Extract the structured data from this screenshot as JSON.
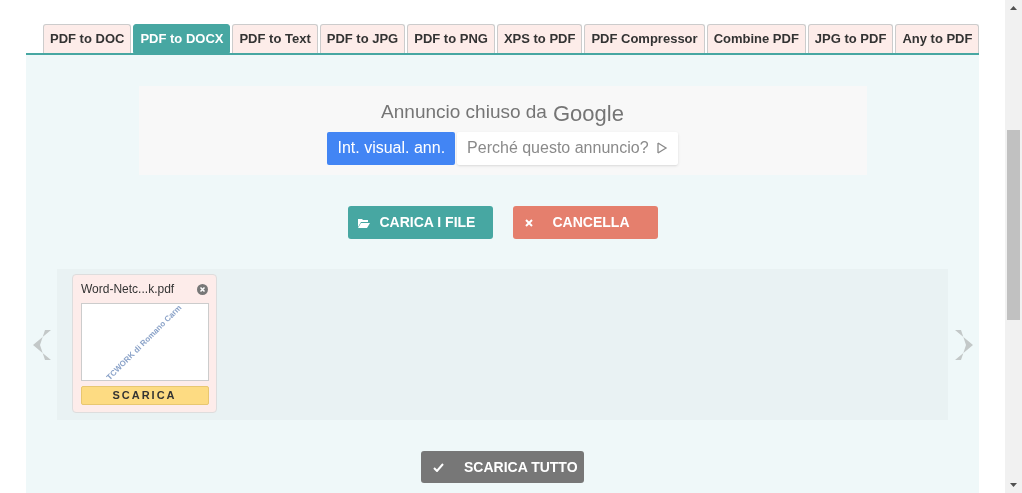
{
  "tabs": [
    {
      "label": "PDF to DOC",
      "selected": false
    },
    {
      "label": "PDF to DOCX",
      "selected": true
    },
    {
      "label": "PDF to Text",
      "selected": false
    },
    {
      "label": "PDF to JPG",
      "selected": false
    },
    {
      "label": "PDF to PNG",
      "selected": false
    },
    {
      "label": "XPS to PDF",
      "selected": false
    },
    {
      "label": "PDF Compressor",
      "selected": false
    },
    {
      "label": "Combine PDF",
      "selected": false
    },
    {
      "label": "JPG to PDF",
      "selected": false
    },
    {
      "label": "Any to PDF",
      "selected": false
    }
  ],
  "ad": {
    "title": "Annuncio chiuso da",
    "brand": "Google",
    "primary_button": "Int. visual. ann.",
    "secondary_button": "Perché questo annuncio?"
  },
  "actions": {
    "upload": "CARICA I FILE",
    "cancel": "CANCELLA"
  },
  "files": [
    {
      "name": "Word-Netc...k.pdf",
      "thumbnail_text": "TCWORK di Romano Carm",
      "download": "SCARICA"
    }
  ],
  "download_all": "SCARICA TUTTO"
}
